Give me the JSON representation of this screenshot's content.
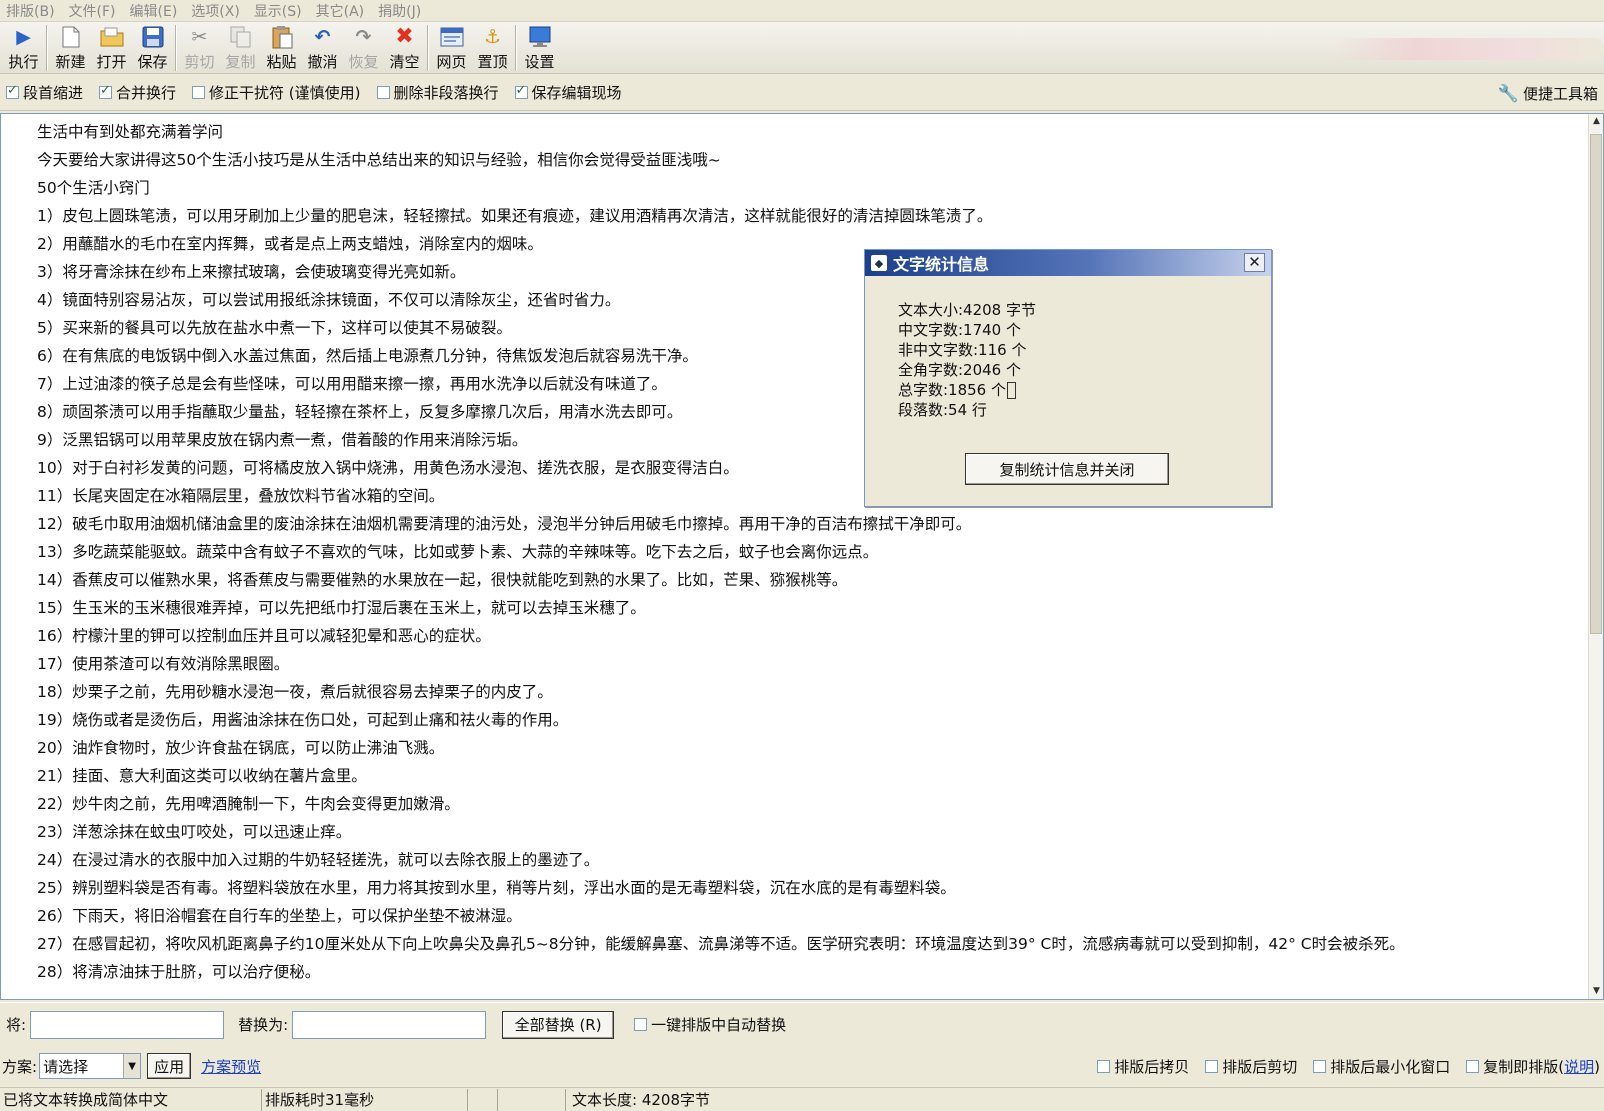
{
  "menu": [
    "排版(B)",
    "文件(F)",
    "编辑(E)",
    "选项(X)",
    "显示(S)",
    "其它(A)",
    "捐助(J)"
  ],
  "toolbar": {
    "execute": "执行",
    "new": "新建",
    "open": "打开",
    "save": "保存",
    "cut": "剪切",
    "copy": "复制",
    "paste": "粘贴",
    "undo": "撤消",
    "redo": "恢复",
    "clear": "清空",
    "webpage": "网页",
    "top": "置顶",
    "settings": "设置"
  },
  "options": {
    "indent": {
      "label": "段首缩进",
      "checked": true
    },
    "merge_newline": {
      "label": "合并换行",
      "checked": true
    },
    "fix_interference": {
      "label": "修正干扰符 (谨慎使用)",
      "checked": false
    },
    "remove_non_paragraph": {
      "label": "删除非段落换行",
      "checked": false
    },
    "save_state": {
      "label": "保存编辑现场",
      "checked": true
    },
    "quick_toolbox": "便捷工具箱"
  },
  "editor": {
    "lines": [
      "生活中有到处都充满着学问",
      "今天要给大家讲得这50个生活小技巧是从生活中总结出来的知识与经验，相信你会觉得受益匪浅哦~",
      "50个生活小窍门",
      "1）皮包上圆珠笔渍，可以用牙刷加上少量的肥皂沫，轻轻擦拭。如果还有痕迹，建议用酒精再次清洁，这样就能很好的清洁掉圆珠笔渍了。",
      "2）用蘸醋水的毛巾在室内挥舞，或者是点上两支蜡烛，消除室内的烟味。",
      "3）将牙膏涂抹在纱布上来擦拭玻璃，会使玻璃变得光亮如新。",
      "4）镜面特别容易沾灰，可以尝试用报纸涂抹镜面，不仅可以清除灰尘，还省时省力。",
      "5）买来新的餐具可以先放在盐水中煮一下，这样可以使其不易破裂。",
      "6）在有焦底的电饭锅中倒入水盖过焦面，然后插上电源煮几分钟，待焦饭发泡后就容易洗干净。",
      "7）上过油漆的筷子总是会有些怪味，可以用用醋来擦一擦，再用水洗净以后就没有味道了。",
      "8）顽固茶渍可以用手指蘸取少量盐，轻轻擦在茶杯上，反复多摩擦几次后，用清水洗去即可。",
      "9）泛黑铝锅可以用苹果皮放在锅内煮一煮，借着酸的作用来消除污垢。",
      "10）对于白衬衫发黄的问题，可将橘皮放入锅中烧沸，用黄色汤水浸泡、搓洗衣服，是衣服变得洁白。",
      "11）长尾夹固定在冰箱隔层里，叠放饮料节省冰箱的空间。",
      "12）破毛巾取用油烟机储油盒里的废油涂抹在油烟机需要清理的油污处，浸泡半分钟后用破毛巾擦掉。再用干净的百洁布擦拭干净即可。",
      "13）多吃蔬菜能驱蚊。蔬菜中含有蚊子不喜欢的气味，比如或萝卜素、大蒜的辛辣味等。吃下去之后，蚊子也会离你远点。",
      "14）香蕉皮可以催熟水果，将香蕉皮与需要催熟的水果放在一起，很快就能吃到熟的水果了。比如，芒果、猕猴桃等。",
      "15）生玉米的玉米穗很难弄掉，可以先把纸巾打湿后裹在玉米上，就可以去掉玉米穗了。",
      "16）柠檬汁里的钾可以控制血压并且可以减轻犯晕和恶心的症状。",
      "17）使用茶渣可以有效消除黑眼圈。",
      "18）炒栗子之前，先用砂糖水浸泡一夜，煮后就很容易去掉栗子的内皮了。",
      "19）烧伤或者是烫伤后，用酱油涂抹在伤口处，可起到止痛和祛火毒的作用。",
      "20）油炸食物时，放少许食盐在锅底，可以防止沸油飞溅。",
      "21）挂面、意大利面这类可以收纳在薯片盒里。",
      "22）炒牛肉之前，先用啤酒腌制一下，牛肉会变得更加嫩滑。",
      "23）洋葱涂抹在蚊虫叮咬处，可以迅速止痒。",
      "24）在浸过清水的衣服中加入过期的牛奶轻轻搓洗，就可以去除衣服上的墨迹了。",
      "25）辨别塑料袋是否有毒。将塑料袋放在水里，用力将其按到水里，稍等片刻，浮出水面的是无毒塑料袋，沉在水底的是有毒塑料袋。",
      "26）下雨天，将旧浴帽套在自行车的坐垫上，可以保护坐垫不被淋湿。",
      "27）在感冒起初，将吹风机距离鼻子约10厘米处从下向上吹鼻尖及鼻孔5~8分钟，能缓解鼻塞、流鼻涕等不适。医学研究表明：环境温度达到39° C时，流感病毒就可以受到抑制，42° C时会被杀死。",
      "28）将清凉油抹于肚脐，可以治疗便秘。"
    ]
  },
  "dialog": {
    "title": "文字统计信息",
    "stats": [
      "文本大小:4208 字节",
      "中文字数:1740 个",
      "非中文字数:116 个",
      "全角字数:2046 个",
      "总字数:1856 个",
      "段落数:54 行"
    ],
    "button": "复制统计信息并关闭"
  },
  "replace": {
    "find_label": "将:",
    "find_value": "",
    "replace_label": "替换为:",
    "replace_value": "",
    "replace_all": "全部替换 (R)",
    "auto_replace": {
      "label": "一键排版中自动替换",
      "checked": false
    }
  },
  "plan": {
    "label": "方案:",
    "selected": "请选择",
    "apply": "应用",
    "preview": "方案预览",
    "copy_after": "排版后拷贝",
    "cut_after": "排版后剪切",
    "minimize_after": "排版后最小化窗口",
    "copy_then_format": "复制即排版",
    "help_open": "(",
    "help": "说明",
    "help_close": ")"
  },
  "status": {
    "message": "已将文本转换成简体中文",
    "time": "排版耗时31毫秒",
    "empty1": "",
    "empty2": "",
    "length": "文本长度: 4208字节"
  }
}
